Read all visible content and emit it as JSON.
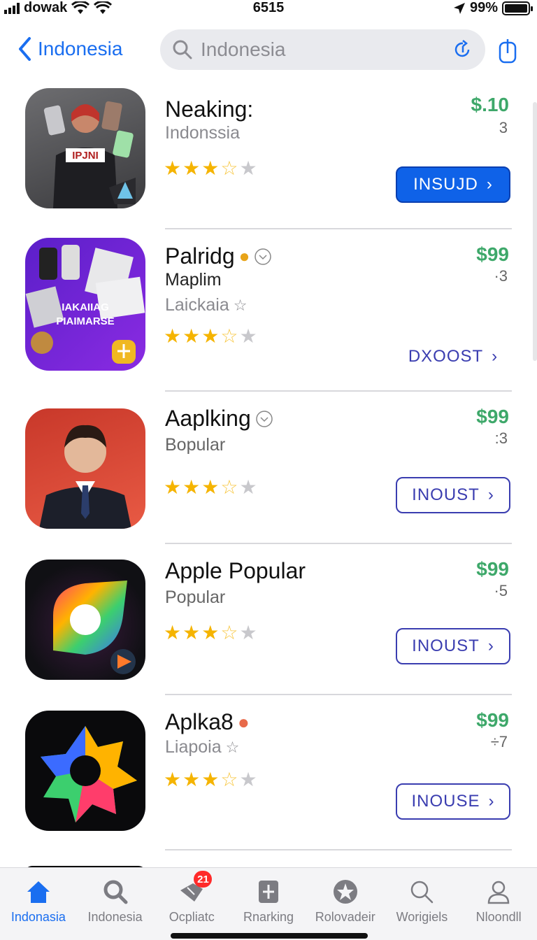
{
  "status": {
    "carrier": "dowak",
    "time": "6515",
    "battery": "99%",
    "battery_level": 0.99
  },
  "nav": {
    "back_label": "Indonesia",
    "search_placeholder": "Indonesia"
  },
  "apps": [
    {
      "name": "Neaking:",
      "sub": "Indonssia",
      "sub2": "",
      "price": "$.10",
      "count": "3",
      "rating": 3.5,
      "button": "INSUJD",
      "button_style": "filled"
    },
    {
      "name": "Palridg",
      "sub": "Maplim",
      "sub2": "Laickaia",
      "price": "$99",
      "count": "·3",
      "rating": 3.5,
      "button": "DXOOST",
      "button_style": "plain"
    },
    {
      "name": "Aaplking",
      "sub": "Bopular",
      "sub2": "",
      "price": "$99",
      "count": ":3",
      "rating": 3.5,
      "button": "INOUST",
      "button_style": "outline"
    },
    {
      "name": "Apple Popular",
      "sub": "Popular",
      "sub2": "",
      "price": "$99",
      "count": "·5",
      "rating": 3.5,
      "button": "INOUST",
      "button_style": "outline"
    },
    {
      "name": "Aplka8",
      "sub": "Liapoia",
      "sub2": "",
      "price": "$99",
      "count": "÷7",
      "rating": 3.5,
      "button": "INOUSE",
      "button_style": "outline"
    }
  ],
  "tabs": [
    {
      "label": "Indonasia",
      "icon": "home-icon",
      "active": true
    },
    {
      "label": "Indonesia",
      "icon": "search-icon",
      "active": false
    },
    {
      "label": "Ocpliatc",
      "icon": "updates-icon",
      "active": false,
      "badge": "21"
    },
    {
      "label": "Rnarking",
      "icon": "ranking-icon",
      "active": false
    },
    {
      "label": "Rolovadeir",
      "icon": "apps-icon",
      "active": false
    },
    {
      "label": "Worigiels",
      "icon": "search-icon",
      "active": false
    },
    {
      "label": "Nloondll",
      "icon": "profile-icon",
      "active": false
    }
  ],
  "colors": {
    "accent": "#1a6ef0",
    "price": "#3ea86a",
    "star": "#f5b400",
    "button_outline": "#3a3db0"
  }
}
